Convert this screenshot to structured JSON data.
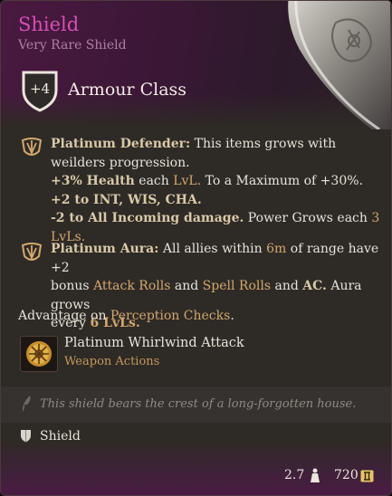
{
  "item": {
    "name": "Shield",
    "rarity": "Very Rare Shield",
    "art_icon": "ornate-shield-art"
  },
  "armour": {
    "value": "+4",
    "label": "Armour Class",
    "icon": "shield-outline-icon"
  },
  "passives": [
    {
      "icon": "platinum-crest-icon",
      "name": "Platinum Defender:",
      "text": " This items grows with weilders progression.",
      "bonuses": [
        {
          "b1": "+3% Health",
          "t1": " each ",
          "h1": "LvL.",
          "t2": " To a Maximum of +30%."
        },
        {
          "b1": "+2 to INT, WIS, CHA."
        },
        {
          "b1": "-2 to All Incoming damage.",
          "t1": " Power Grows each ",
          "h1": "3 LvLs."
        }
      ]
    },
    {
      "icon": "platinum-crest-icon",
      "name": "Platinum Aura:",
      "t1": " All allies within ",
      "h1": "6m",
      "t2": " of range have +2",
      "t3": "bonus ",
      "h2": "Attack Rolls",
      "t4": " and ",
      "h3": "Spell Rolls",
      "t5": " and ",
      "h4": "AC.",
      "t6": " Aura grows",
      "t7": "every ",
      "h5": "6 LvLs."
    }
  ],
  "advantage": {
    "t1": "Advantage on ",
    "h1": "Perception Checks",
    "t2": "."
  },
  "action": {
    "icon": "whirlwind-attack-icon",
    "name": "Platinum Whirlwind Attack",
    "type": "Weapon Actions"
  },
  "flavor": {
    "icon": "quill-icon",
    "text": "This shield bears the crest of a long-forgotten house."
  },
  "category": {
    "icon": "shield-category-icon",
    "label": "Shield"
  },
  "footer": {
    "weight": "2.7",
    "weight_icon": "weight-icon",
    "price": "720",
    "price_icon": "gold-coin-icon"
  },
  "colors": {
    "title": "#d54fb7",
    "rarity": "#b07ea9",
    "highlight": "#d2a86e",
    "background": "#2e2a26",
    "header": "#4a1940"
  }
}
